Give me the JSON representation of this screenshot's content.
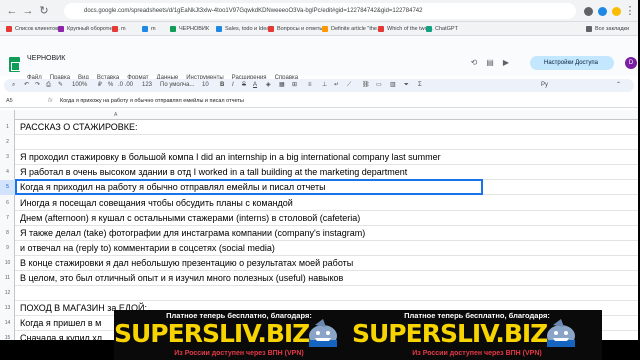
{
  "browser": {
    "url": "docs.google.com/spreadsheets/d/1gEaNkJt3xlw-4too1V97GqwkdKDNweeeoO3Va-bgIPc/edit#gid=122784742&gid=122784742",
    "bookmarks": [
      {
        "label": "Список клиентов",
        "color": "#e53935"
      },
      {
        "label": "Крупный оборотны...",
        "color": "#8e24aa"
      },
      {
        "label": "m",
        "color": "#e53935"
      },
      {
        "label": "m",
        "color": "#1e88e5"
      },
      {
        "label": "ЧЕРНОВИК",
        "color": "#0f9d58"
      },
      {
        "label": "Sales, todo и Ideа...",
        "color": "#1e88e5"
      },
      {
        "label": "Вопросы и ответы...",
        "color": "#e53935"
      },
      {
        "label": "Definite article \"the...",
        "color": "#ff9800"
      },
      {
        "label": "Which of the two ...",
        "color": "#e53935"
      },
      {
        "label": "ChatGPT",
        "color": "#10a37f"
      },
      {
        "label": "Все закладки",
        "color": "#5f6368"
      }
    ]
  },
  "header": {
    "title": "ЧЕРНОВИК",
    "menu": [
      "Файл",
      "Правка",
      "Вид",
      "Вставка",
      "Формат",
      "Данные",
      "Инструменты",
      "Расширения",
      "Справка"
    ],
    "share_label": "Настройки Доступа",
    "avatar_letter": "D"
  },
  "toolbar": {
    "zoom": "100%",
    "currency": "₽",
    "percent": "%",
    "decimals": ".0  .00",
    "format": "123",
    "font": "По умолча...",
    "font_size": "10",
    "bold": "B",
    "italic": "I",
    "strike": "S",
    "text_color": "A",
    "sum": "Σ",
    "input_tools": "Pу"
  },
  "formula_bar": {
    "cell_ref": "A5",
    "fx": "fx",
    "content": "Когда я прихожу на работу я обычно отправлял емейлы и писал отчеты"
  },
  "grid": {
    "column_label": "A",
    "rows": [
      {
        "num": "1",
        "text": "РАССКАЗ О СТАЖИРОВКЕ:"
      },
      {
        "num": "2",
        "text": ""
      },
      {
        "num": "3",
        "text": "Я проходил стажировку в большой компа I did an internship in a big international company last summer"
      },
      {
        "num": "4",
        "text": "Я работал в очень высоком здании в отд I worked in a tall building at the marketing department"
      },
      {
        "num": "5",
        "text": "Когда я приходил на работу я обычно отправлял емейлы и писал отчеты"
      },
      {
        "num": "6",
        "text": "Иногда я посещал совещания чтобы обсудить планы с командой"
      },
      {
        "num": "7",
        "text": "Днем (afternoon) я кушал с остальными стажерами (interns) в столовой (cafeteria)"
      },
      {
        "num": "8",
        "text": "Я также делал (take) фотографии для инстаграма компании (company's instagram)"
      },
      {
        "num": "9",
        "text": "и отвечал на (reply to) комментарии в соцсетях (social media)"
      },
      {
        "num": "10",
        "text": "В конце стажировки я дал небольшую презентацию о результатах моей работы"
      },
      {
        "num": "11",
        "text": "В целом, это был отличный опыт и я изучил много полезных (useful) навыков"
      },
      {
        "num": "12",
        "text": ""
      },
      {
        "num": "13",
        "text": "ПОХОД В МАГАЗИН за ЕДОЙ:"
      },
      {
        "num": "14",
        "text": "Когда я пришел в м"
      },
      {
        "num": "15",
        "text": "Сначала я купил хл"
      }
    ]
  },
  "banner": {
    "top_text": "Платное теперь бесплатно, благодаря:",
    "brand": "SUPERSLIV.BIZ",
    "bottom_text": "Из России доступен через ВПН (VPN)"
  }
}
